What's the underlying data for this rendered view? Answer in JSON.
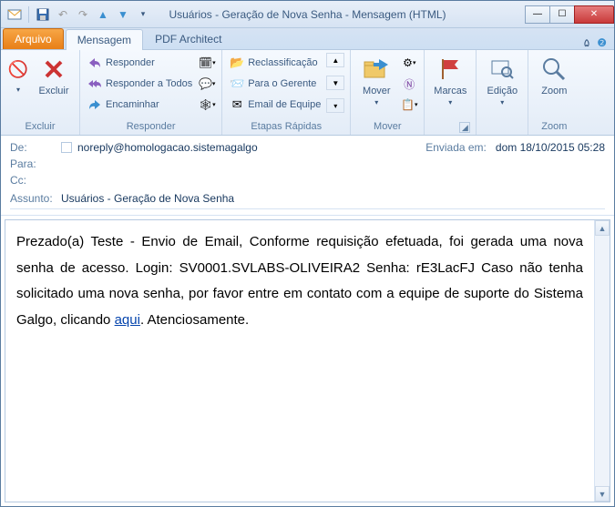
{
  "window": {
    "title": "Usuários - Geração de Nova Senha - Mensagem (HTML)"
  },
  "tabs": {
    "file": "Arquivo",
    "message": "Mensagem",
    "pdf": "PDF Architect"
  },
  "ribbon": {
    "delete": {
      "label": "Excluir",
      "btn": "Excluir"
    },
    "respond": {
      "label": "Responder",
      "reply": "Responder",
      "reply_all": "Responder a Todos",
      "forward": "Encaminhar"
    },
    "quick": {
      "label": "Etapas Rápidas",
      "reclass": "Reclassificação",
      "manager": "Para o Gerente",
      "team": "Email de Equipe"
    },
    "move": {
      "label": "Mover",
      "btn": "Mover"
    },
    "tags": {
      "label": "Marcas",
      "btn": "Marcas"
    },
    "edit": {
      "label": "Edição",
      "btn": "Edição"
    },
    "zoom": {
      "label": "Zoom",
      "btn": "Zoom"
    }
  },
  "headers": {
    "from_lbl": "De:",
    "from_val": "noreply@homologacao.sistemagalgo",
    "sent_lbl": "Enviada em:",
    "sent_val": "dom 18/10/2015 05:28",
    "to_lbl": "Para:",
    "cc_lbl": "Cc:",
    "subj_lbl": "Assunto:",
    "subj_val": "Usuários - Geração de Nova Senha"
  },
  "body": {
    "p1a": "Prezado(a) Teste - Envio de Email, Conforme requisição efetuada, foi gerada uma nova senha de acesso. Login: SV0001.SVLABS-OLIVEIRA2 Senha: rE3LacFJ Caso não tenha solicitado uma nova senha, por favor entre em contato com a equipe de suporte do Sistema Galgo, clicando ",
    "link": "aqui",
    "p1b": ". Atenciosamente."
  }
}
